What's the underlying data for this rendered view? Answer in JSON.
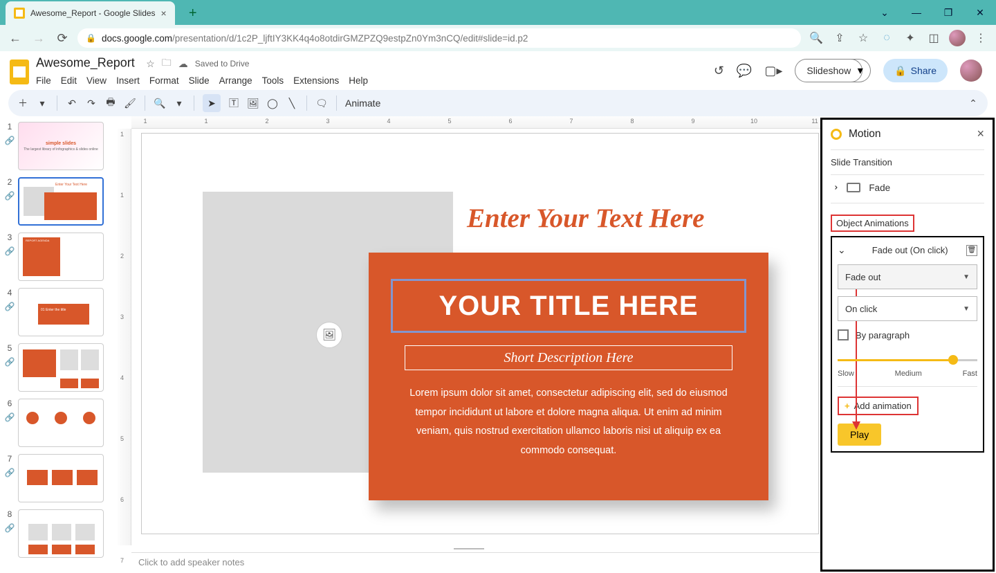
{
  "chrome": {
    "tab_title": "Awesome_Report - Google Slides",
    "url_host": "docs.google.com",
    "url_path": "/presentation/d/1c2P_ljftIY3KK4q4o8otdirGMZPZQ9estpZn0Ym3nCQ/edit#slide=id.p2"
  },
  "app": {
    "doc_title": "Awesome_Report",
    "saved_status": "Saved to Drive",
    "menus": [
      "File",
      "Edit",
      "View",
      "Insert",
      "Format",
      "Slide",
      "Arrange",
      "Tools",
      "Extensions",
      "Help"
    ],
    "slideshow_label": "Slideshow",
    "share_label": "Share",
    "animate_label": "Animate"
  },
  "ruler_h": [
    "1",
    "",
    "1",
    "2",
    "3",
    "4",
    "5",
    "6",
    "7",
    "8",
    "9",
    "10",
    "11"
  ],
  "ruler_v": [
    "1",
    "",
    "1",
    "2",
    "3",
    "4",
    "5",
    "6",
    "7"
  ],
  "slide": {
    "heading": "Enter Your Text Here",
    "title": "YOUR TITLE HERE",
    "desc": "Short Description Here",
    "body": "Lorem ipsum dolor sit amet, consectetur adipiscing elit, sed do eiusmod tempor incididunt ut labore et dolore magna aliqua. Ut enim ad minim veniam, quis nostrud exercitation ullamco laboris nisi ut aliquip ex ea commodo consequat."
  },
  "notes_placeholder": "Click to add speaker notes",
  "panel": {
    "title": "Motion",
    "section_transition": "Slide Transition",
    "transition_value": "Fade",
    "section_object": "Object Animations",
    "anim_label": "Fade out  (On click)",
    "type_value": "Fade out",
    "trigger_value": "On click",
    "by_paragraph": "By paragraph",
    "speed_labels": [
      "Slow",
      "Medium",
      "Fast"
    ],
    "add_label": "Add animation",
    "play_label": "Play"
  },
  "thumbs": {
    "t1_title": "simple slides",
    "t1_sub": "The largest library of infographics & slides online",
    "t2_head": "Enter Your Text Here",
    "t3_head": "REPORT AGENDA",
    "t4_num": "01 Enter the title"
  }
}
